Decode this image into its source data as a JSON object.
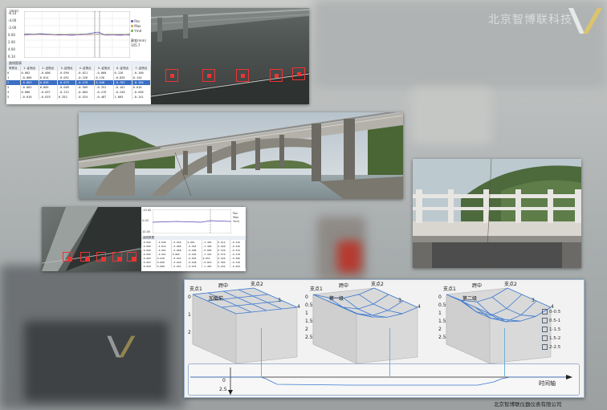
{
  "watermark": {
    "top_right": "北京智博联科技",
    "company_footer": "北京智博联仪器仪表有限公司"
  },
  "panel1": {
    "chart": {
      "y_unit": "(mm)",
      "y_ticks": [
        "-6.14",
        "-4.00",
        "-2.00",
        "0.00",
        "2.00",
        "4.00",
        "6.14"
      ],
      "legend": [
        "Pos",
        "Max",
        "Ymd"
      ],
      "side_label": "静变(mm)",
      "side_value": "105.7"
    },
    "table": {
      "title": "曲线图表",
      "headers": [
        "采样点",
        "1-证测点",
        "2-证测点",
        "3-证测点",
        "4-证测点",
        "5-证测点",
        "6-证测点",
        "7-证测点"
      ],
      "rows": [
        [
          "0",
          "0.002",
          "-0.006",
          "-0.094",
          "-0.021",
          "-0.060",
          "0.126",
          "-0.160"
        ],
        [
          "1",
          "-0.006",
          "0.014",
          "-0.051",
          "-0.226",
          "0.126",
          "-0.026",
          "0.144"
        ],
        [
          "2",
          "-0.003",
          "0.036",
          "-0.079",
          "-0.278",
          "0.048",
          "-0.702",
          "-0.184"
        ],
        [
          "3",
          "-0.003",
          "0.005",
          "-0.009",
          "-0.509",
          "-0.251",
          "-0.181",
          "0.016"
        ],
        [
          "4",
          "0.006",
          "-0.037",
          "-0.212",
          "-0.004",
          "-0.219",
          "-0.240",
          "-0.036"
        ],
        [
          "5",
          "-0.016",
          "-0.019",
          "0.352",
          "-0.524",
          "-0.487",
          "1.003",
          "-0.141"
        ]
      ],
      "selected_row": 2
    }
  },
  "panel3": {
    "chart_ticks": [
      "-10.00",
      "0.00",
      "10.00"
    ],
    "legend": [
      "Pos",
      "Max",
      "Ymd"
    ],
    "table_title": "曲线数据",
    "rows": [
      [
        "-0.066",
        "-0.046",
        "-0.059",
        "0.001",
        "-1.402",
        "0.512",
        "-0.316"
      ],
      [
        "-0.060",
        "-0.012",
        "-0.006",
        "-0.054",
        "-1.306",
        "0.629",
        "-0.329"
      ],
      [
        "-0.060",
        "-0.061",
        "-0.068",
        "-0.000",
        "-0.000",
        "0.530",
        "-0.334"
      ],
      [
        "-0.066",
        "-0.051",
        "0.065",
        "-0.020",
        "-1.393",
        "0.579",
        "-0.378"
      ],
      [
        "-0.065",
        "0.018",
        "-0.023",
        "-0.055",
        "0.053",
        "0.526",
        "-0.300"
      ],
      [
        "-0.063",
        "0.068",
        "-0.026",
        "-0.048",
        "-0.023",
        "0.505",
        "-0.318"
      ],
      [
        "-0.059",
        "0.008",
        "-0.051",
        "-0.076",
        "-1.403",
        "0.632",
        "-0.294"
      ]
    ]
  },
  "panel5": {
    "charts": [
      {
        "top_left": "支点1",
        "top_mid": "跨中",
        "top_right": "支点2",
        "stage": "加载前",
        "num3": "3",
        "num4": "4"
      },
      {
        "top_left": "支点1",
        "top_mid": "跨中",
        "top_right": "支点2",
        "stage": "第一级",
        "num3": "3",
        "num4": "4"
      },
      {
        "top_left": "支点1",
        "top_mid": "跨中",
        "top_right": "支点2",
        "stage": "第二级",
        "num3": "3",
        "num4": "4"
      }
    ],
    "z_ticks_a": [
      "0",
      "1",
      "2"
    ],
    "z_ticks_b": [
      "0",
      "0.5",
      "1",
      "1.5",
      "2",
      "2.5"
    ],
    "legend": [
      "0-0.5",
      "0.5-1",
      "1-1.5",
      "1.5-2",
      "2-2.5"
    ],
    "timeline": {
      "label": "时间轴",
      "tick0": "0",
      "tick1": "2.5"
    }
  },
  "colors": {
    "accent": "#3a6fc4",
    "marker": "#e33333",
    "mesh": "#3a78d0"
  }
}
